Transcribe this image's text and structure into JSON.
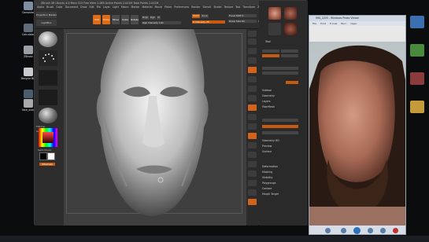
{
  "desktop": {
    "left_icons": [
      {
        "label": "Computer",
        "color": "#7d8fa3"
      },
      {
        "label": "Calculator",
        "color": "#5f6b78"
      },
      {
        "label": "ZBrush",
        "color": "#9aa0a6"
      },
      {
        "label": "Recycle Bin",
        "color": "#c8ccd1"
      },
      {
        "label": "Mudbox",
        "color": "#4a5c6e"
      },
      {
        "label": "face_scan",
        "color": "#a8a8a8"
      }
    ],
    "right_icons": [
      {
        "color": "#3a6fb0"
      },
      {
        "color": "#4a8a3c"
      },
      {
        "color": "#8a3c3c"
      },
      {
        "color": "#c59b3a"
      }
    ]
  },
  "zbrush": {
    "title": "ZBrush 4R  Ubuntu 4.0  Mem 513  Free Mem 2.085  Active Points 2.041M  Total Points 2.041M",
    "menu": [
      "Alpha",
      "Brush",
      "Color",
      "Document",
      "Draw",
      "Edit",
      "File",
      "Layer",
      "Light",
      "Macro",
      "Marker",
      "Material",
      "Movie",
      "Picker",
      "Preferences",
      "Render",
      "Stencil",
      "Stroke",
      "Texture",
      "Tool",
      "Transform",
      "Zplugin",
      "Zscript"
    ],
    "toolbar": {
      "projection_label": "Projection Master",
      "lightbox_label": "LightBox",
      "buttons": [
        "Edit",
        "Draw",
        "Move",
        "Scale",
        "Rotate"
      ],
      "mrgb": "Mrgb",
      "rgb": "Rgb",
      "m": "M",
      "zadd": "Zadd",
      "zsub": "Zsub",
      "rgb_intensity": "Rgb Intensity 100",
      "z_intensity": "Z Intensity 25",
      "focal_shift": "Focal Shift 0",
      "draw_size": "Draw Size 64",
      "dynamic": "Dynamic"
    },
    "left_shelf": {
      "material_label": "MatCap",
      "gradient_label": "Gradient",
      "switch_label": "SwitchColor",
      "alternate_label": "Alternate"
    },
    "right_panel": {
      "rows": [
        "Subtool",
        "Geometry",
        "Layers",
        "FiberMesh",
        "Geometry HD",
        "Preview",
        "Surface",
        "Deformation",
        "Masking",
        "Visibility",
        "Polygroups",
        "Contact",
        "Morph Target"
      ],
      "tool_label": "Tool"
    }
  },
  "viewer": {
    "title": "IMG_2205 - Windows Photo Viewer",
    "menu": [
      "File",
      "Print",
      "E-mail",
      "Burn",
      "Open"
    ]
  },
  "accent_color": "#e06b16"
}
